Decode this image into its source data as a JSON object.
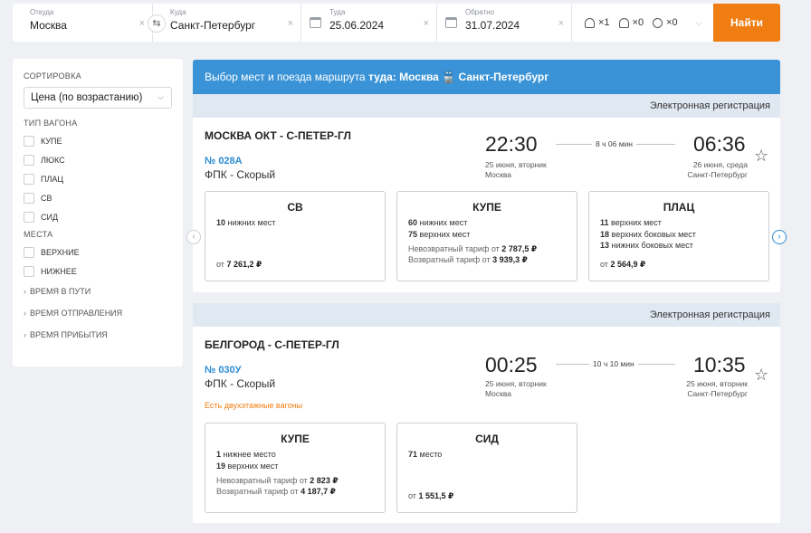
{
  "search": {
    "from_label": "Откуда",
    "from_value": "Москва",
    "to_label": "Куда",
    "to_value": "Санкт-Петербург",
    "there_label": "Туда",
    "there_value": "25.06.2024",
    "back_label": "Обратно",
    "back_value": "31.07.2024",
    "adults": "×1",
    "children": "×0",
    "infants": "×0",
    "find_label": "Найти",
    "clear_glyph": "×",
    "swap_glyph": "⇆"
  },
  "filters": {
    "sort_title": "СОРТИРОВКА",
    "sort_value": "Цена (по возрастанию)",
    "wagon_title": "ТИП ВАГОНА",
    "wagon_types": [
      "КУПЕ",
      "ЛЮКС",
      "ПЛАЦ",
      "СВ",
      "СИД"
    ],
    "places_title": "МЕСТА",
    "places": [
      "ВЕРХНИЕ",
      "НИЖНЕЕ"
    ],
    "collapsible": [
      "ВРЕМЯ В ПУТИ",
      "ВРЕМЯ ОТПРАВЛЕНИЯ",
      "ВРЕМЯ ПРИБЫТИЯ"
    ]
  },
  "banner": {
    "prefix": "Выбор мест и поезда маршрута ",
    "direction": "туда: Москва",
    "train_glyph": "🚆",
    "destination": "Санкт-Петербург"
  },
  "trains": [
    {
      "ereg": "Электронная регистрация",
      "route": "МОСКВА ОКТ - С-ПЕТЕР-ГЛ",
      "number": "№ 028А",
      "name": "ФПК - Скорый",
      "dep_time": "22:30",
      "arr_time": "06:36",
      "duration": "8 ч 06 мин",
      "dep_date": "25 июня, вторник",
      "dep_city": "Москва",
      "arr_date": "26 июня, среда",
      "arr_city": "Санкт-Петербург",
      "classes": [
        {
          "name": "СВ",
          "seats": [
            {
              "n": "10",
              "t": "нижних мест"
            }
          ],
          "tariffs": [],
          "price_prefix": "от ",
          "price": "7 261,2 ₽"
        },
        {
          "name": "КУПЕ",
          "seats": [
            {
              "n": "60",
              "t": "нижних мест"
            },
            {
              "n": "75",
              "t": "верхних мест"
            }
          ],
          "tariffs": [
            {
              "label": "Невозвратный тариф от ",
              "price": "2 787,5 ₽"
            },
            {
              "label": "Возвратный тариф от ",
              "price": "3 939,3 ₽"
            }
          ],
          "price_prefix": "",
          "price": ""
        },
        {
          "name": "ПЛАЦ",
          "seats": [
            {
              "n": "11",
              "t": "верхних мест"
            },
            {
              "n": "18",
              "t": "верхних боковых мест"
            },
            {
              "n": "13",
              "t": "нижних боковых мест"
            }
          ],
          "tariffs": [],
          "price_prefix": "от ",
          "price": "2 564,9 ₽"
        }
      ]
    },
    {
      "ereg": "Электронная регистрация",
      "route": "БЕЛГОРОД - С-ПЕТЕР-ГЛ",
      "number": "№ 030У",
      "name": "ФПК - Скорый",
      "double_decker": "Есть двухэтажные вагоны",
      "dep_time": "00:25",
      "arr_time": "10:35",
      "duration": "10 ч 10 мин",
      "dep_date": "25 июня, вторник",
      "dep_city": "Москва",
      "arr_date": "25 июня, вторник",
      "arr_city": "Санкт-Петербург",
      "classes": [
        {
          "name": "КУПЕ",
          "seats": [
            {
              "n": "1",
              "t": "нижнее место"
            },
            {
              "n": "19",
              "t": "верхних мест"
            }
          ],
          "tariffs": [
            {
              "label": "Невозвратный тариф от ",
              "price": "2 823 ₽"
            },
            {
              "label": "Возвратный тариф от ",
              "price": "4 187,7 ₽"
            }
          ],
          "price_prefix": "",
          "price": ""
        },
        {
          "name": "СИД",
          "seats": [
            {
              "n": "71",
              "t": "место"
            }
          ],
          "tariffs": [],
          "price_prefix": "от ",
          "price": "1 551,5 ₽"
        }
      ]
    }
  ],
  "icons": {
    "star": "☆",
    "nav_left": "‹",
    "nav_right": "›",
    "dropdown": "⌵",
    "caret": "›"
  },
  "colors": {
    "accent_orange": "#f07d11",
    "banner_blue": "#3a93d6",
    "link_blue": "#2b8bd3",
    "ereg_bg": "#e0e8f1"
  }
}
